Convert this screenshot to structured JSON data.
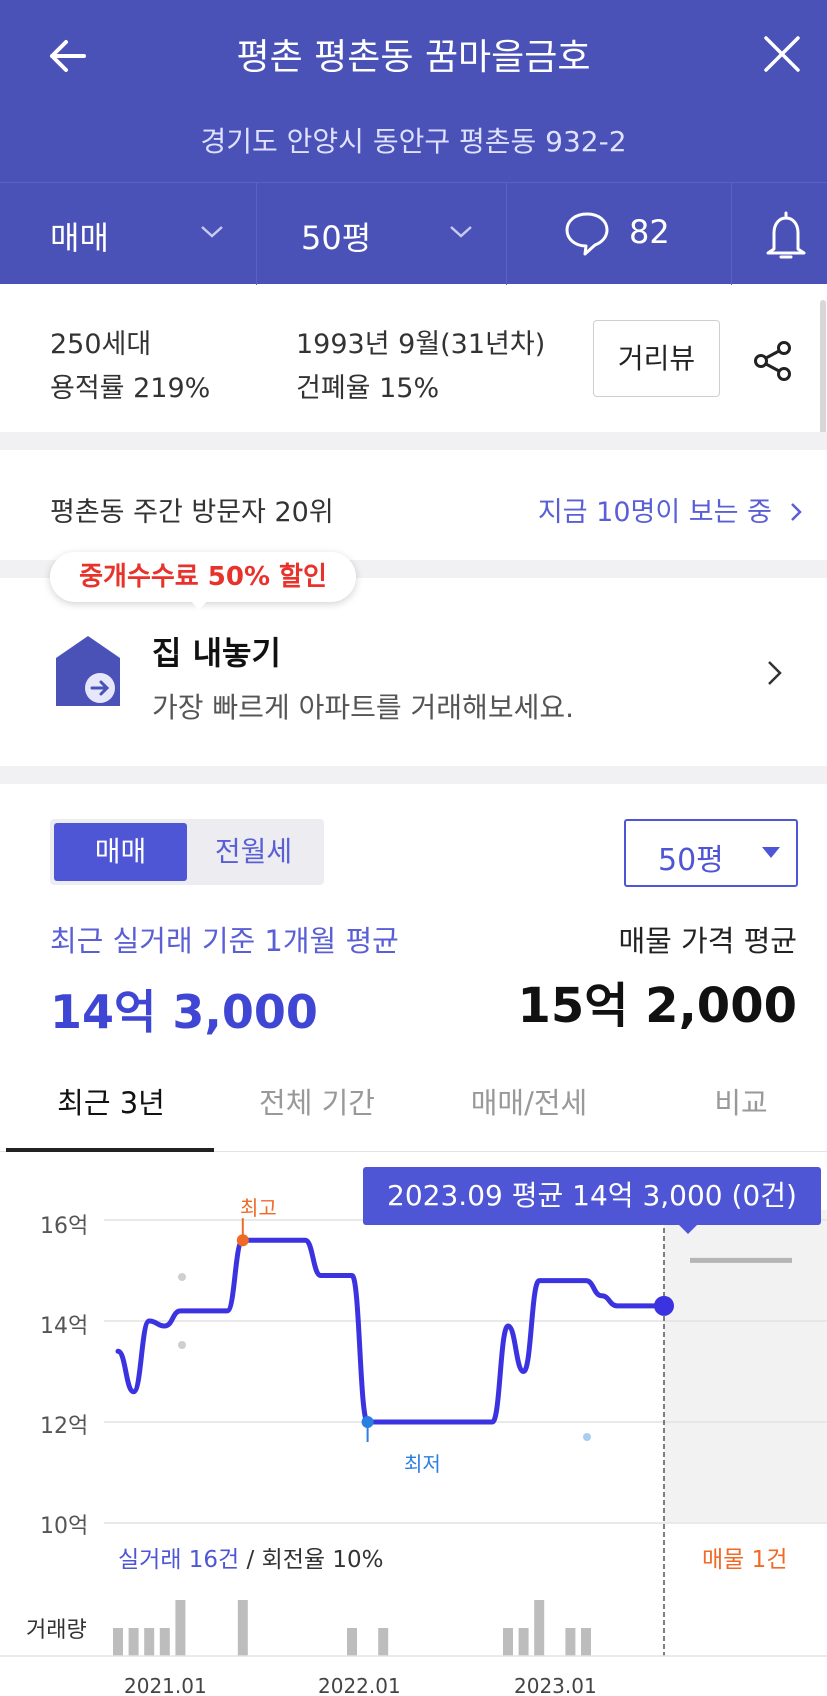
{
  "header": {
    "title": "평촌 평촌동 꿈마을금호",
    "address": "경기도 안양시 동안구 평촌동 932-2",
    "trade_type": "매매",
    "size": "50평",
    "comment_count": "82",
    "bg_color": "#4a52b8"
  },
  "info": {
    "households": "250세대",
    "floor_area_ratio": "용적률 219%",
    "built": "1993년 9월(31년차)",
    "coverage_ratio": "건폐율 15%",
    "street_view_label": "거리뷰"
  },
  "visitors": {
    "rank_text": "평촌동 주간 방문자 20위",
    "now_viewing": "지금 10명이 보는 중"
  },
  "promo": {
    "badge": "중개수수료 50% 할인",
    "title": "집 내놓기",
    "description": "가장 빠르게 아파트를 거래해보세요."
  },
  "trade": {
    "segment_active": "매매",
    "segment_inactive": "전월세",
    "size_select": "50평",
    "recent_label": "최근 실거래 기준 1개월 평균",
    "recent_value": "14억 3,000",
    "listing_label": "매물 가격 평균",
    "listing_value": "15억 2,000"
  },
  "tabs": [
    "최근 3년",
    "전체 기간",
    "매매/전세",
    "비교"
  ],
  "chart": {
    "tooltip": "2023.09 평균 14억 3,000 (0건)",
    "high_marker": "최고",
    "low_marker": "최저",
    "trade_count": "실거래 16건",
    "turnover": " / 회전율 10%",
    "listing_count": "매물 1건",
    "volume_label": "거래량"
  },
  "chart_data": {
    "type": "line",
    "ylabel": "",
    "y_ticks": [
      "16억",
      "14억",
      "12억",
      "10억"
    ],
    "ylim": [
      10,
      16.5
    ],
    "x_ticks": [
      "2021.01",
      "2022.01",
      "2023.01"
    ],
    "series": [
      {
        "values": [
          {
            "x": "2020.10",
            "y": 13.4
          },
          {
            "x": "2020.11",
            "y": 12.6
          },
          {
            "x": "2020.12",
            "y": 14.0
          },
          {
            "x": "2021.01",
            "y": 13.9
          },
          {
            "x": "2021.02",
            "y": 14.2
          },
          {
            "x": "2021.03",
            "y": 14.2
          },
          {
            "x": "2021.04",
            "y": 14.2
          },
          {
            "x": "2021.05",
            "y": 14.2
          },
          {
            "x": "2021.06",
            "y": 15.6
          },
          {
            "x": "2021.07",
            "y": 15.6
          },
          {
            "x": "2021.08",
            "y": 15.6
          },
          {
            "x": "2021.09",
            "y": 15.6
          },
          {
            "x": "2021.10",
            "y": 15.6
          },
          {
            "x": "2021.11",
            "y": 14.9
          },
          {
            "x": "2021.12",
            "y": 14.9
          },
          {
            "x": "2022.01",
            "y": 14.9
          },
          {
            "x": "2022.02",
            "y": 12.0
          },
          {
            "x": "2022.03",
            "y": 12.0
          },
          {
            "x": "2022.04",
            "y": 12.0
          },
          {
            "x": "2022.05",
            "y": 12.0
          },
          {
            "x": "2022.06",
            "y": 12.0
          },
          {
            "x": "2022.07",
            "y": 12.0
          },
          {
            "x": "2022.08",
            "y": 12.0
          },
          {
            "x": "2022.09",
            "y": 12.0
          },
          {
            "x": "2022.10",
            "y": 12.0
          },
          {
            "x": "2022.11",
            "y": 13.9
          },
          {
            "x": "2022.12",
            "y": 13.0
          },
          {
            "x": "2023.01",
            "y": 14.8
          },
          {
            "x": "2023.02",
            "y": 14.8
          },
          {
            "x": "2023.03",
            "y": 14.8
          },
          {
            "x": "2023.04",
            "y": 14.8
          },
          {
            "x": "2023.05",
            "y": 14.5
          },
          {
            "x": "2023.06",
            "y": 14.3
          },
          {
            "x": "2023.07",
            "y": 14.3
          },
          {
            "x": "2023.08",
            "y": 14.3
          },
          {
            "x": "2023.09",
            "y": 14.3
          }
        ]
      }
    ],
    "listing_price": 15.2,
    "high": {
      "x": "2021.06",
      "y": 15.6
    },
    "low": {
      "x": "2022.02",
      "y": 12.0
    },
    "volume": [
      {
        "x": "2020.10",
        "v": 1
      },
      {
        "x": "2020.11",
        "v": 1
      },
      {
        "x": "2020.12",
        "v": 1
      },
      {
        "x": "2021.01",
        "v": 1
      },
      {
        "x": "2021.02",
        "v": 2
      },
      {
        "x": "2021.06",
        "v": 2
      },
      {
        "x": "2022.01",
        "v": 1
      },
      {
        "x": "2022.03",
        "v": 1
      },
      {
        "x": "2022.11",
        "v": 1
      },
      {
        "x": "2022.12",
        "v": 1
      },
      {
        "x": "2023.01",
        "v": 2
      },
      {
        "x": "2023.03",
        "v": 1
      },
      {
        "x": "2023.04",
        "v": 1
      }
    ]
  }
}
